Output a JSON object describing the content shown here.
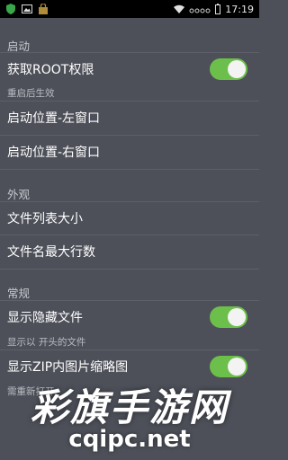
{
  "status_bar": {
    "time": "17:19",
    "left_icons": [
      "shield-icon",
      "image-icon",
      "lock-bag-icon"
    ],
    "right_icons": [
      "wifi-icon",
      "signal-icon",
      "battery-icon"
    ]
  },
  "sections": {
    "startup": {
      "header": "启动",
      "root_access": {
        "label": "获取ROOT权限",
        "sub": "重启后生效",
        "enabled": true
      },
      "left_window": {
        "label": "启动位置-左窗口"
      },
      "right_window": {
        "label": "启动位置-右窗口"
      }
    },
    "appearance": {
      "header": "外观",
      "file_list_size": {
        "label": "文件列表大小"
      },
      "filename_max_lines": {
        "label": "文件名最大行数"
      }
    },
    "general": {
      "header": "常规",
      "show_hidden": {
        "label": "显示隐藏文件",
        "sub": "显示以 开头的文件",
        "enabled": true
      },
      "zip_thumbnails": {
        "label": "显示ZIP内图片缩略图",
        "sub": "需重新打开",
        "enabled": true
      }
    }
  },
  "watermark": {
    "line1": "彩旗手游网",
    "line2": "cqipc.net"
  },
  "colors": {
    "background": "#4d5059",
    "toggle_on": "#6dbf4b",
    "status_bar": "#000000"
  }
}
